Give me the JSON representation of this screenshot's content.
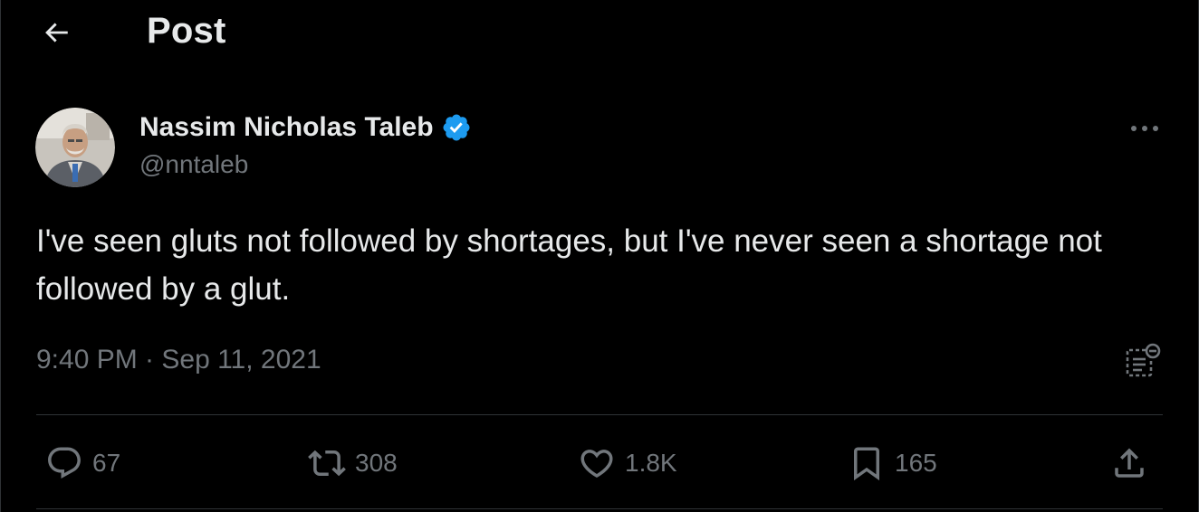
{
  "header": {
    "title": "Post"
  },
  "author": {
    "name": "Nassim Nicholas Taleb",
    "handle": "@nntaleb",
    "verified": true
  },
  "post": {
    "text": "I've seen gluts not followed by shortages, but I've never seen a shortage not followed by a glut.",
    "timestamp": "9:40 PM · Sep 11, 2021"
  },
  "actions": {
    "replies": "67",
    "reposts": "308",
    "likes": "1.8K",
    "bookmarks": "165"
  },
  "colors": {
    "background": "#000000",
    "text": "#e7e9ea",
    "muted": "#71767b",
    "verified": "#1d9bf0",
    "divider": "#2f3336"
  },
  "icons": {
    "back": "arrow-left-icon",
    "verified": "verified-badge-icon",
    "more": "more-horizontal-icon",
    "analytics": "analytics-icon",
    "reply": "reply-icon",
    "repost": "repost-icon",
    "like": "heart-icon",
    "bookmark": "bookmark-icon",
    "share": "share-icon"
  }
}
